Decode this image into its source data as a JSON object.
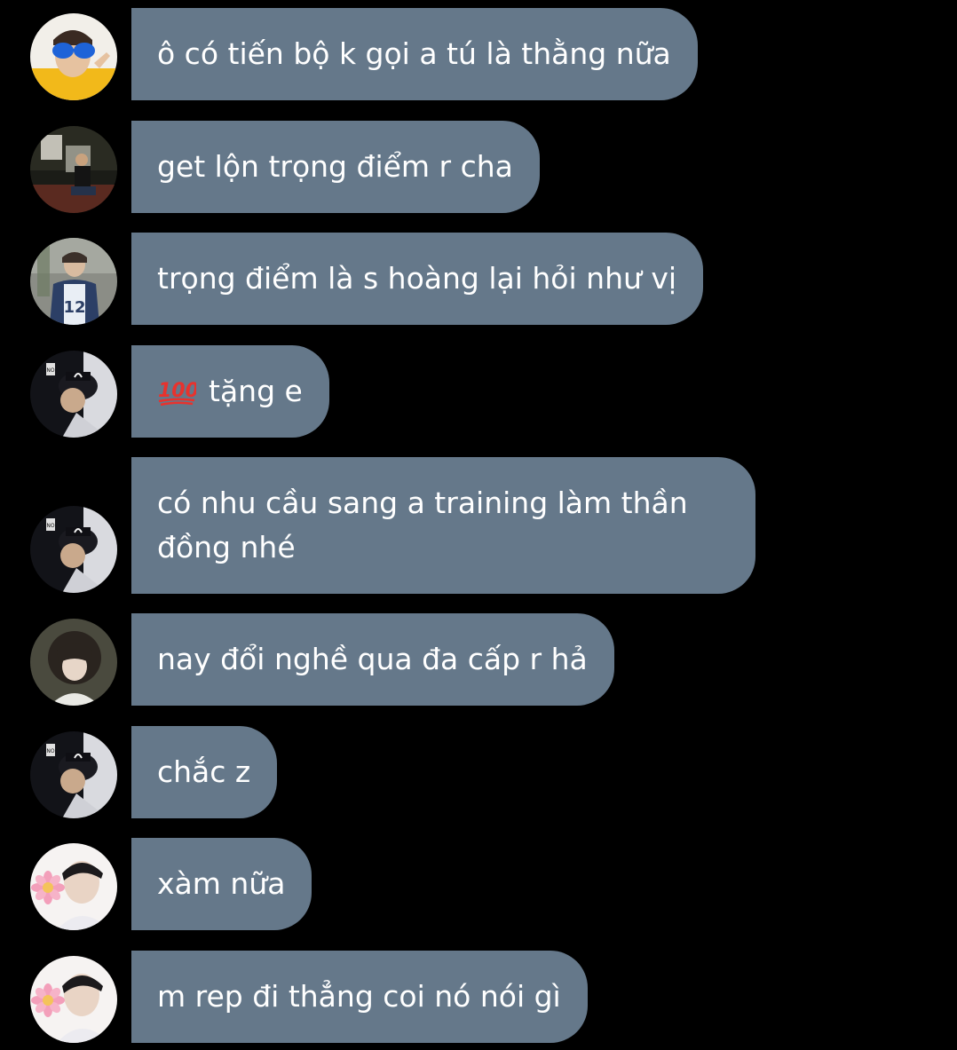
{
  "messages": [
    {
      "avatar": "avatar-yellow-sunglasses",
      "text": "ô có tiến bộ k gọi a tú là thằng nữa"
    },
    {
      "avatar": "avatar-night-street",
      "text": "get lộn trọng điểm r cha"
    },
    {
      "avatar": "avatar-jersey-12",
      "text": "trọng điểm là s hoàng lại hỏi như vị"
    },
    {
      "avatar": "avatar-cap-boy",
      "icon": "hundred-points-icon",
      "text": "tặng e"
    },
    {
      "avatar": "avatar-cap-boy",
      "text": "có nhu cầu sang a training làm thần đồng nhé"
    },
    {
      "avatar": "avatar-curly-hair",
      "text": "nay đổi nghề qua đa cấp r hả"
    },
    {
      "avatar": "avatar-cap-boy",
      "text": "chắc z"
    },
    {
      "avatar": "avatar-flower-boy",
      "text": "xàm nữa"
    },
    {
      "avatar": "avatar-flower-boy",
      "text": "m rep đi thẳng coi nó nói gì"
    }
  ],
  "colors": {
    "background": "#000000",
    "bubble": "#65788a",
    "text": "#ffffff",
    "hundred_icon": "#e8322d"
  }
}
